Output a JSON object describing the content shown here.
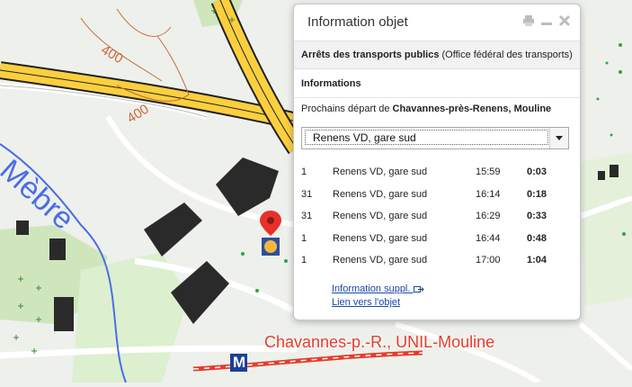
{
  "map": {
    "river_label": "Mèbre",
    "contour_labels": [
      "400",
      "400"
    ],
    "station_label": "Chavannes-p.-R., UNIL-Mouline",
    "metro_symbol": "M",
    "colors": {
      "road_fill": "#fbcf3e",
      "road_casing": "#222222",
      "water": "#4a6ee6",
      "forest": "#cfe6bd",
      "building": "#2a2a2a",
      "station_label": "#e83b2a",
      "contour": "#c46a3a"
    }
  },
  "panel": {
    "title": "Information objet",
    "print_icon": "printer-icon",
    "minimize_icon": "minimize-icon",
    "close_icon": "close-icon",
    "layer_name": "Arrêts des transports publics",
    "layer_source": "(Office fédéral des transports)",
    "section_title": "Informations",
    "next_prefix": "Prochains départ de",
    "stop_name": "Chavannes-près-Renens, Mouline",
    "select_value": "Renens VD, gare sud",
    "departures": [
      {
        "line": "1",
        "destination": "Renens VD, gare sud",
        "time": "15:59",
        "in": "0:03"
      },
      {
        "line": "31",
        "destination": "Renens VD, gare sud",
        "time": "16:14",
        "in": "0:18"
      },
      {
        "line": "31",
        "destination": "Renens VD, gare sud",
        "time": "16:29",
        "in": "0:33"
      },
      {
        "line": "1",
        "destination": "Renens VD, gare sud",
        "time": "16:44",
        "in": "0:48"
      },
      {
        "line": "1",
        "destination": "Renens VD, gare sud",
        "time": "17:00",
        "in": "1:04"
      }
    ],
    "link_info": "Information suppl.",
    "link_object": "Lien vers l'objet"
  }
}
